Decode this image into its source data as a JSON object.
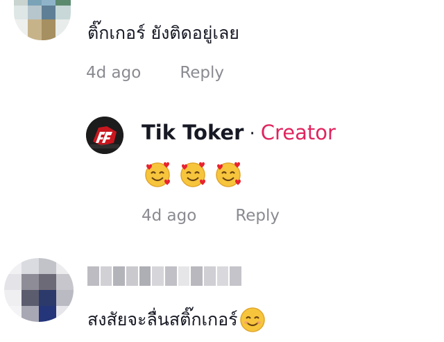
{
  "comment1": {
    "text": "ติ๊กเกอร์ ยังติดอยู่เลย",
    "time": "4d ago",
    "reply_label": "Reply"
  },
  "reply": {
    "author": "Tik Toker",
    "separator": "·",
    "badge": "Creator",
    "time": "4d ago",
    "reply_label": "Reply",
    "emojis": [
      "smiling-face-with-hearts-icon",
      "smiling-face-with-hearts-icon",
      "smiling-face-with-hearts-icon"
    ]
  },
  "comment2": {
    "text": "สงสัยจะลื่นสติ๊กเกอร์",
    "emoji": "smiling-face-icon"
  },
  "colors": {
    "text": "#161823",
    "muted": "#8a8b91",
    "creator": "#e0245e"
  }
}
